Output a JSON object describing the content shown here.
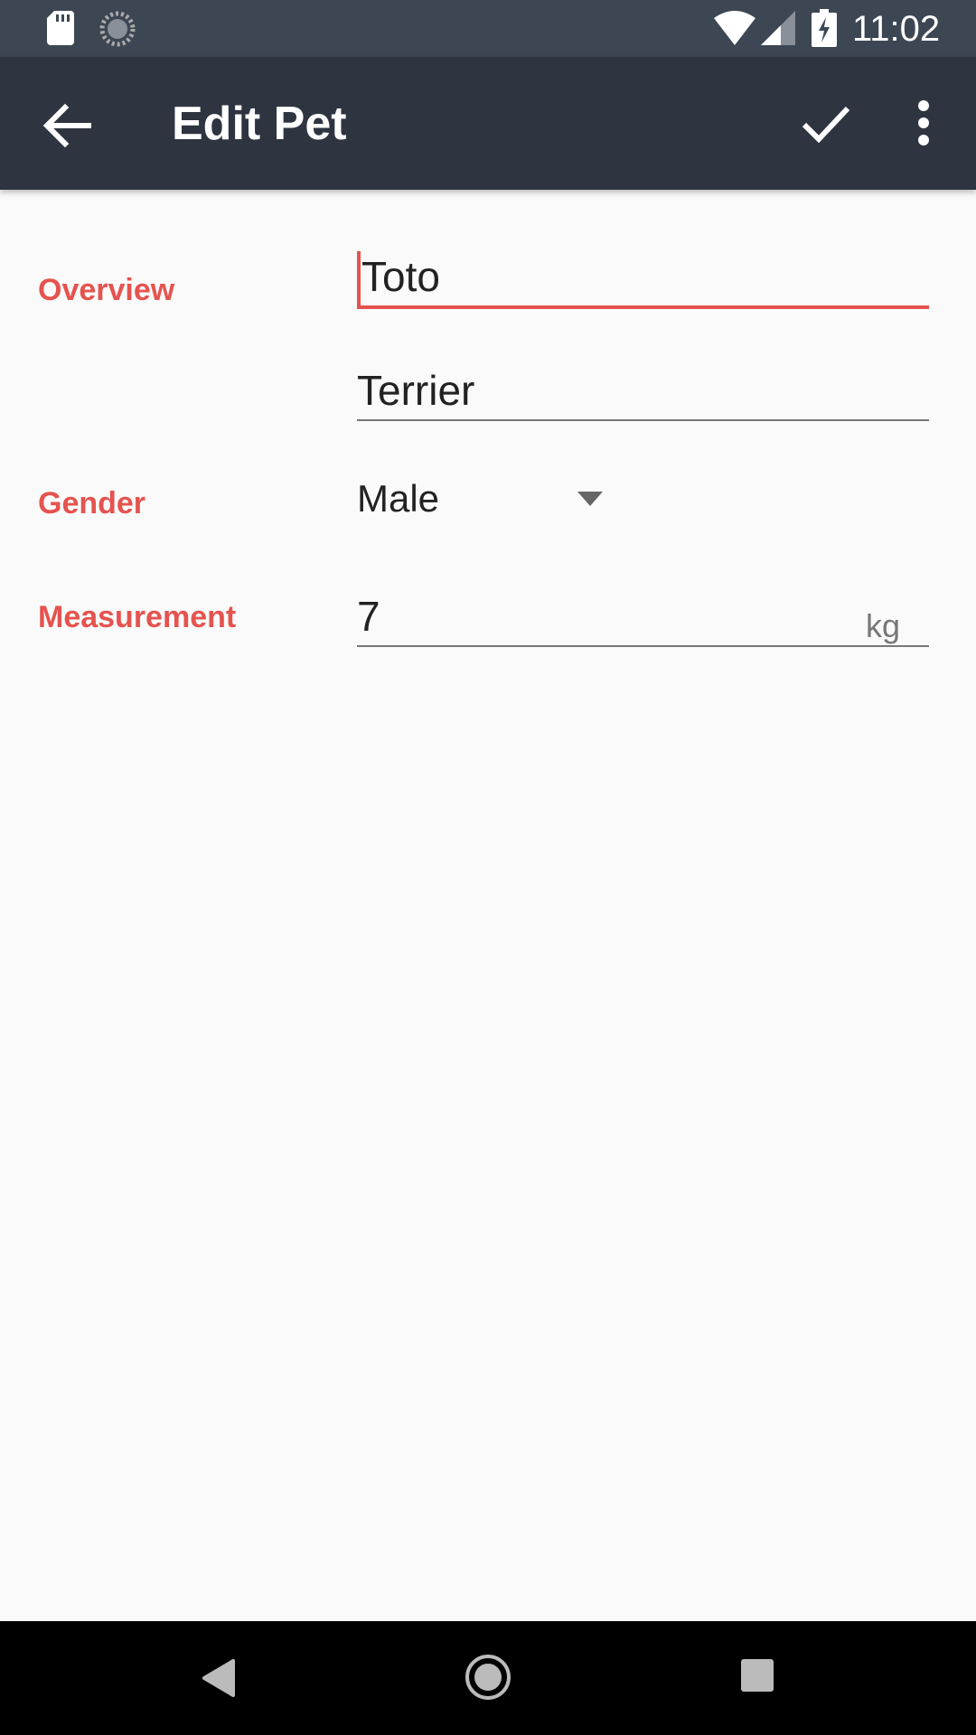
{
  "status_bar": {
    "time": "11:02",
    "icons": [
      "sd-card-icon",
      "sync-icon",
      "wifi-icon",
      "signal-icon",
      "battery-charging-icon"
    ]
  },
  "app_bar": {
    "title": "Edit Pet",
    "icons": [
      "arrow-back-icon",
      "check-icon",
      "more-vert-icon"
    ]
  },
  "form": {
    "overview_label": "Overview",
    "name_value": "Toto",
    "breed_value": "Terrier",
    "gender_label": "Gender",
    "gender_value": "Male",
    "measurement_label": "Measurement",
    "weight_value": "7",
    "weight_unit": "kg"
  },
  "nav_bar": {
    "icons": [
      "nav-back-icon",
      "nav-home-icon",
      "nav-recents-icon"
    ]
  },
  "colors": {
    "accent": "#e5534f",
    "app_bar": "#2e3540",
    "status_bar": "#3d4754",
    "background": "#fafafa"
  }
}
